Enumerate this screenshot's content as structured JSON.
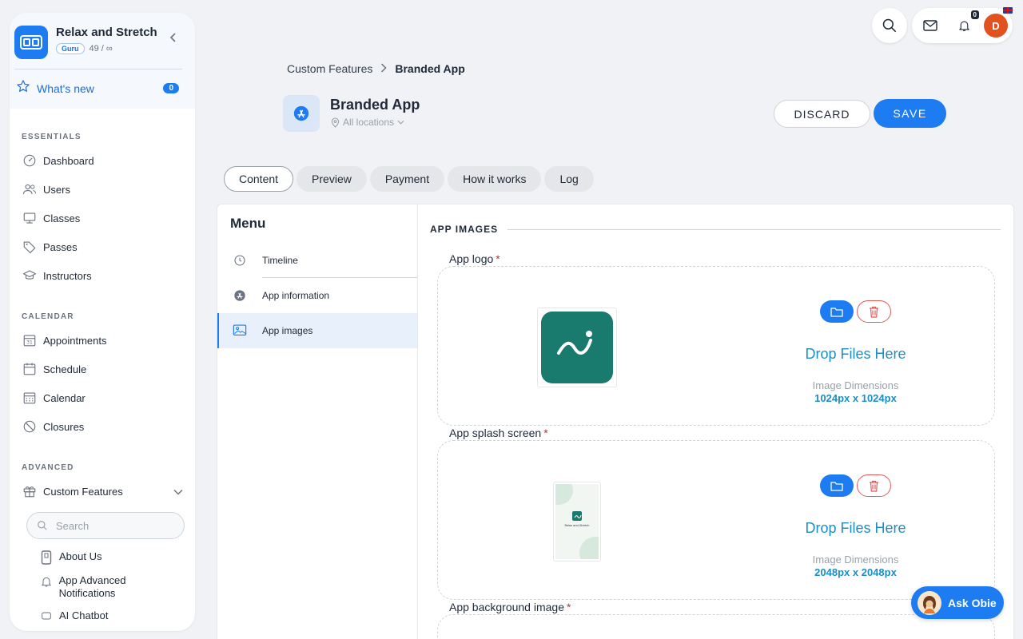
{
  "sidebar": {
    "brand": {
      "name": "Relax and Stretch",
      "badge": "Guru",
      "usage": "49 / ∞"
    },
    "whats_new": {
      "label": "What's new",
      "count": "0"
    },
    "sections": {
      "essentials": "ESSENTIALS",
      "calendar": "CALENDAR",
      "advanced": "ADVANCED"
    },
    "essentials_items": [
      "Dashboard",
      "Users",
      "Classes",
      "Passes",
      "Instructors"
    ],
    "calendar_items": [
      "Appointments",
      "Schedule",
      "Calendar",
      "Closures"
    ],
    "custom_features": "Custom Features",
    "search_placeholder": "Search",
    "sub_items": [
      "About Us",
      "App Advanced Notifications",
      "AI Chatbot"
    ]
  },
  "topbar": {
    "notification_count": "0",
    "avatar_initial": "D"
  },
  "breadcrumb": {
    "parent": "Custom Features",
    "current": "Branded App"
  },
  "header": {
    "title": "Branded App",
    "location": "All locations"
  },
  "actions": {
    "discard": "DISCARD",
    "save": "SAVE"
  },
  "tabs": [
    "Content",
    "Preview",
    "Payment",
    "How it works",
    "Log"
  ],
  "menu": {
    "title": "Menu",
    "items": [
      "Timeline",
      "App information",
      "App images"
    ]
  },
  "content": {
    "section_title": "APP IMAGES",
    "fields": [
      {
        "label": "App logo",
        "required": "*",
        "drop": "Drop Files Here",
        "dim_label": "Image Dimensions",
        "dim": "1024px x 1024px"
      },
      {
        "label": "App splash screen",
        "required": "*",
        "drop": "Drop Files Here",
        "dim_label": "Image Dimensions",
        "dim": "2048px x 2048px"
      },
      {
        "label": "App background image",
        "required": "*"
      }
    ],
    "splash_preview_text": "Relax and Stretch"
  },
  "ask": {
    "label": "Ask Obie"
  },
  "colors": {
    "accent": "#1d7cf2",
    "logo_bg": "#197a6e",
    "link": "#1d8ec4",
    "danger": "#e15a5a"
  }
}
